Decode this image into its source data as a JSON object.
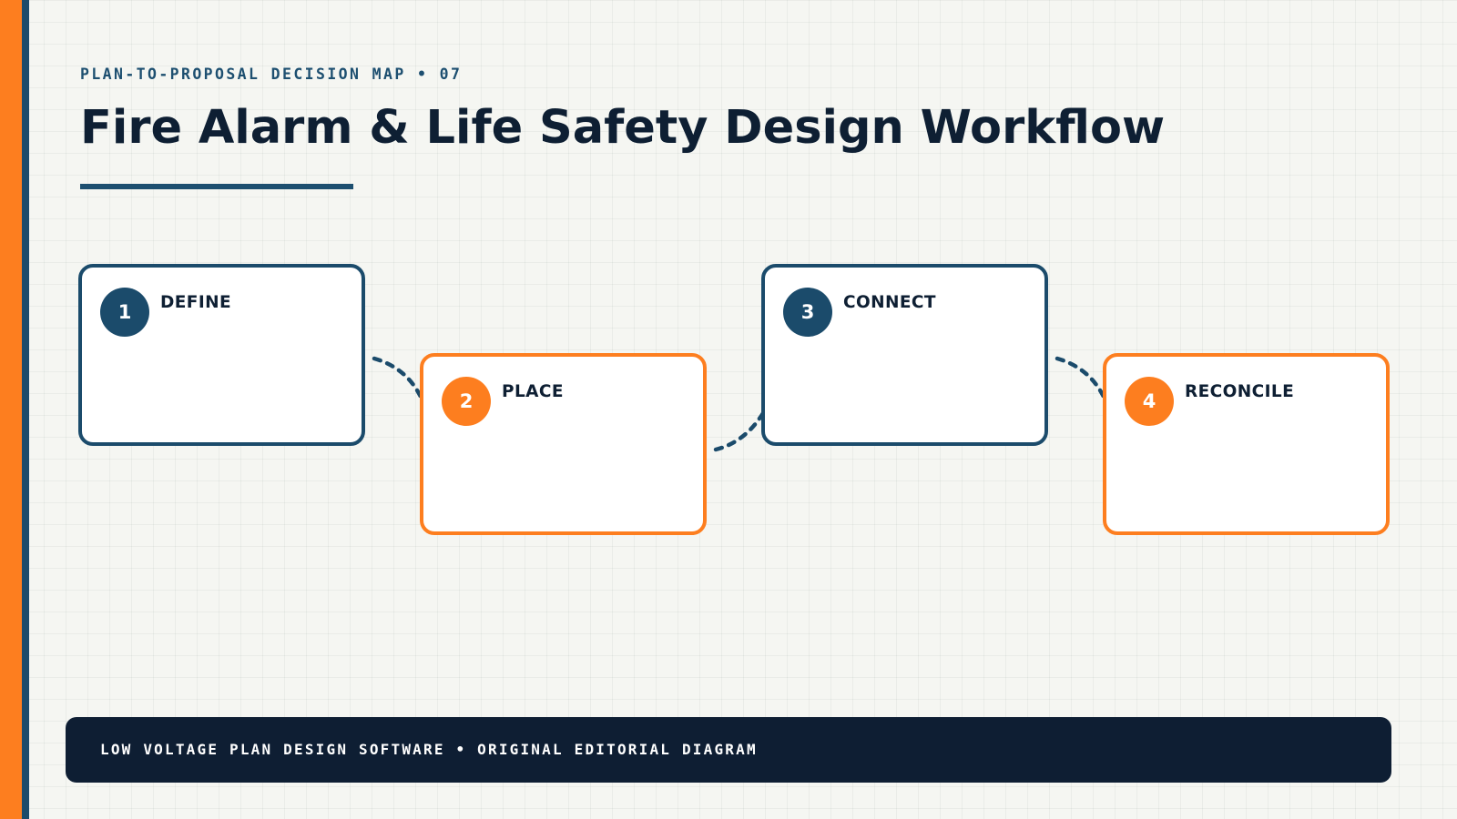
{
  "header": {
    "eyebrow": "PLAN-TO-PROPOSAL DECISION MAP • 07",
    "title": "Fire Alarm & Life Safety Design Workflow"
  },
  "steps": [
    {
      "number": "1",
      "label": "DEFINE"
    },
    {
      "number": "2",
      "label": "PLACE"
    },
    {
      "number": "3",
      "label": "CONNECT"
    },
    {
      "number": "4",
      "label": "RECONCILE"
    }
  ],
  "footer": {
    "text": "LOW VOLTAGE PLAN DESIGN SOFTWARE • ORIGINAL EDITORIAL DIAGRAM"
  },
  "colors": {
    "navy": "#1b4b6b",
    "orange": "#fd7e1f",
    "ink": "#0e1f33",
    "footer": "#0e1e33",
    "background": "#f5f6f2"
  }
}
